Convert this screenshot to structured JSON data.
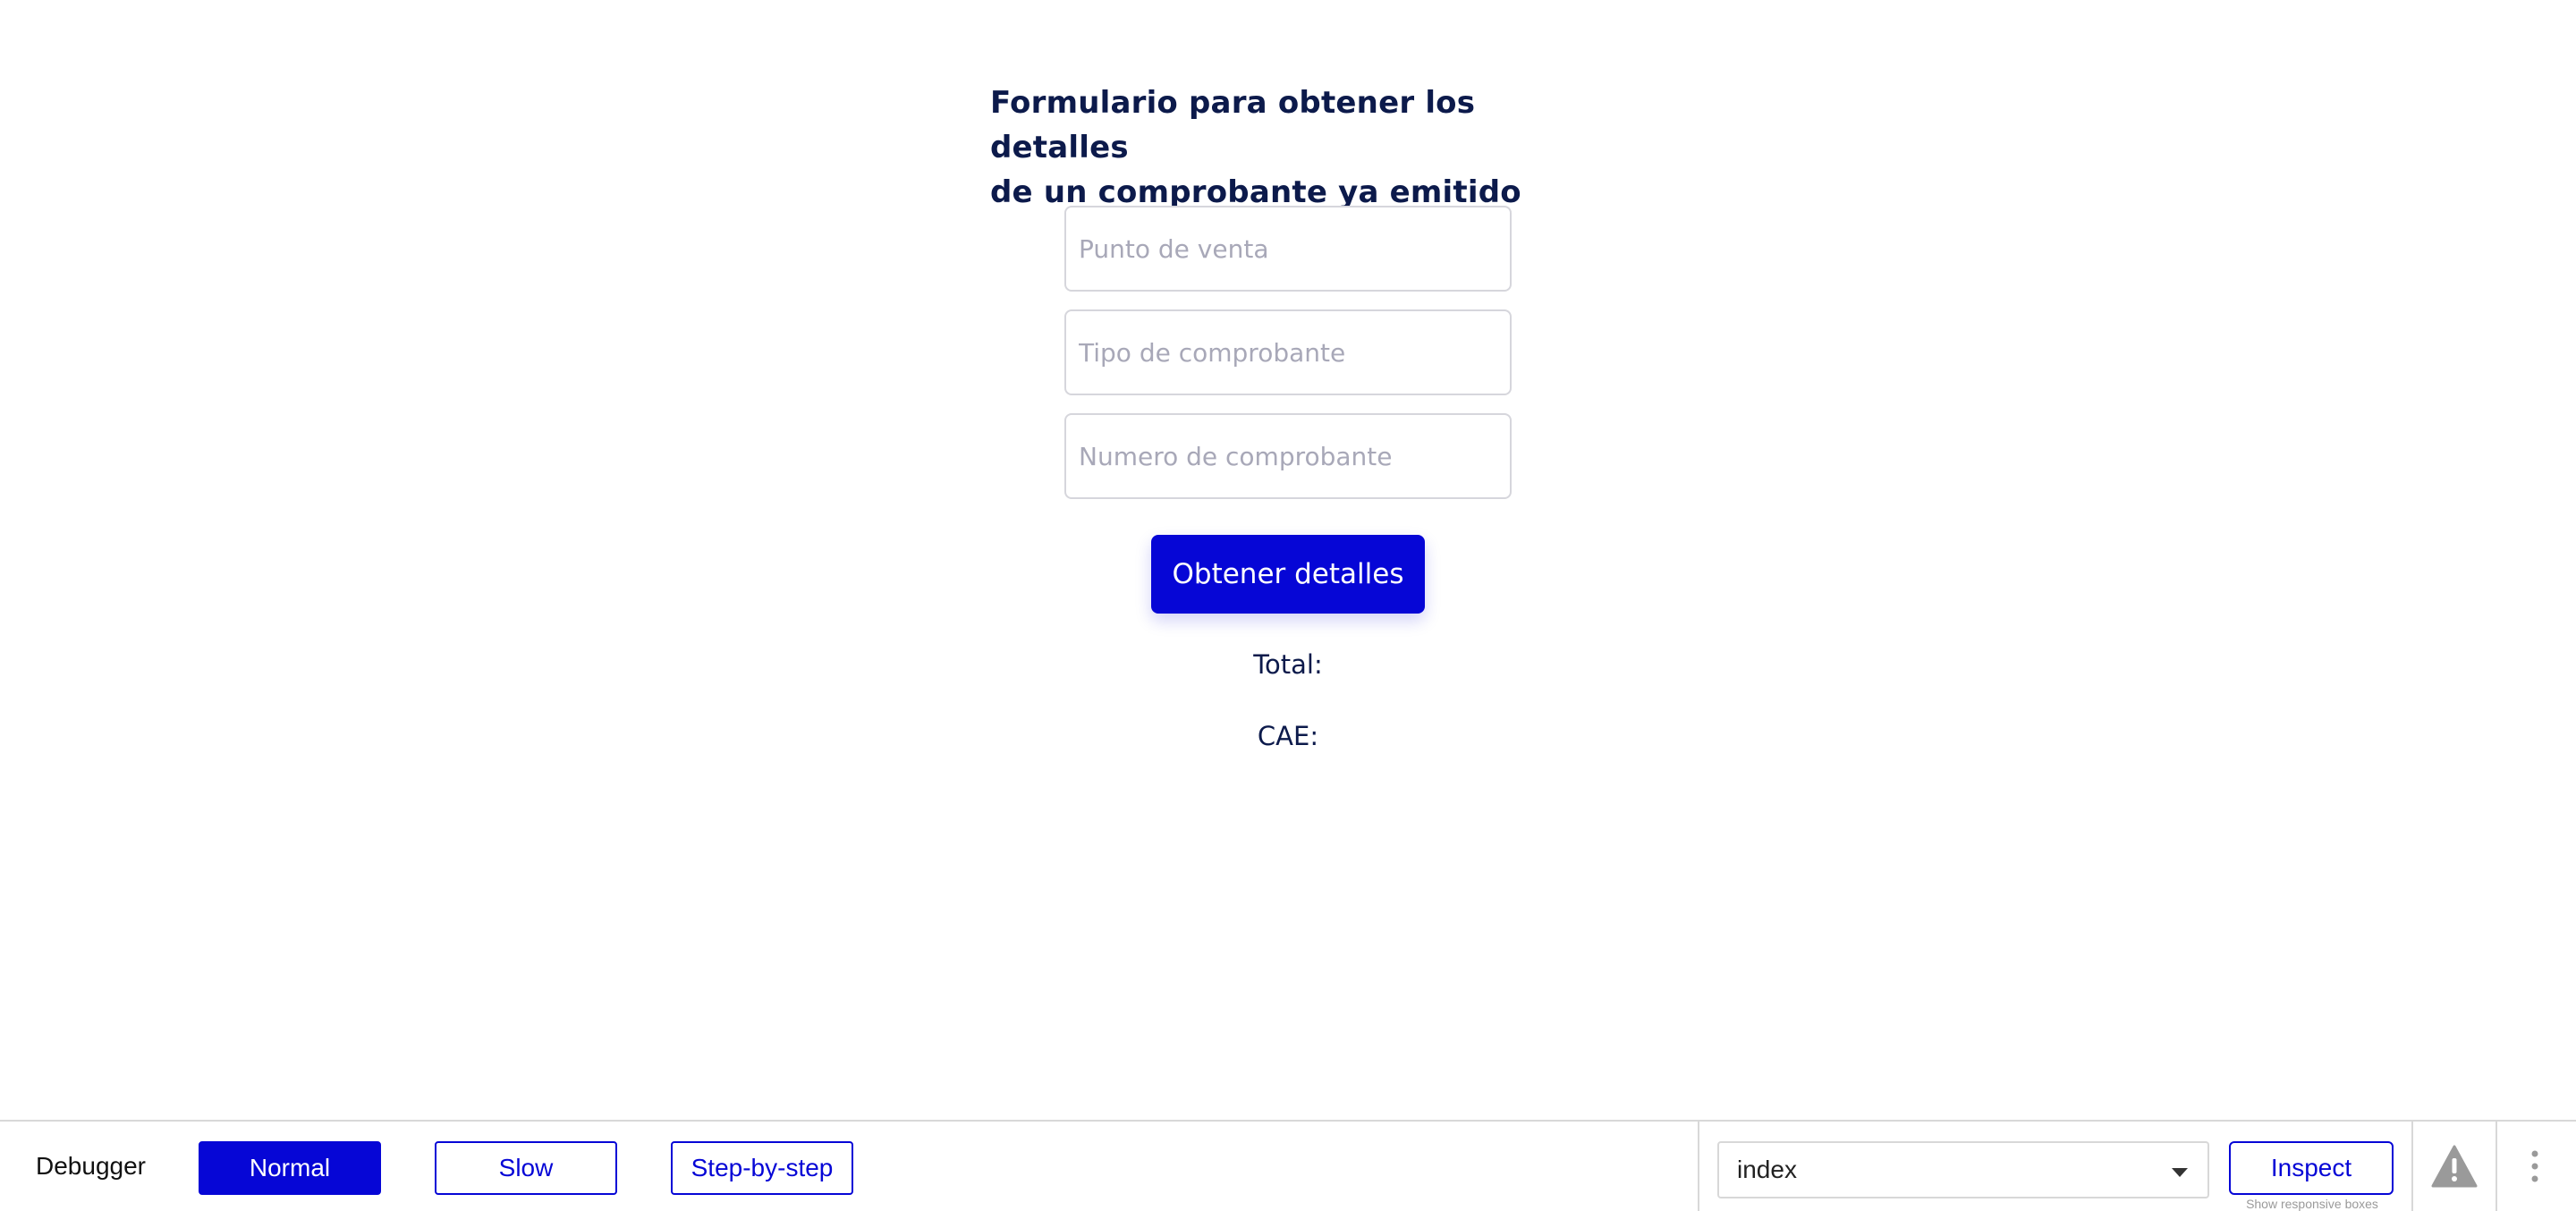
{
  "form": {
    "title_line1": "Formulario para obtener los detalles",
    "title_line2": "de un comprobante ya emitido",
    "punto_venta_placeholder": "Punto de venta",
    "tipo_comprobante_placeholder": "Tipo de comprobante",
    "numero_comprobante_placeholder": "Numero de comprobante",
    "submit_label": "Obtener detalles",
    "total_label": "Total:",
    "cae_label": "CAE:"
  },
  "debugger": {
    "label": "Debugger",
    "modes": [
      "Normal",
      "Slow",
      "Step-by-step"
    ],
    "active_mode": "Normal",
    "page_select_value": "index",
    "inspect_label": "Inspect",
    "responsive_hint": "Show responsive boxes",
    "icons": {
      "warning": "warning-triangle-icon",
      "more": "more-vertical-icon",
      "select_caret": "chevron-down-icon"
    }
  },
  "colors": {
    "primary": "#0606d6",
    "title": "#0c1a4b",
    "placeholder": "#a8a8b8",
    "border": "#d6d6dc"
  }
}
